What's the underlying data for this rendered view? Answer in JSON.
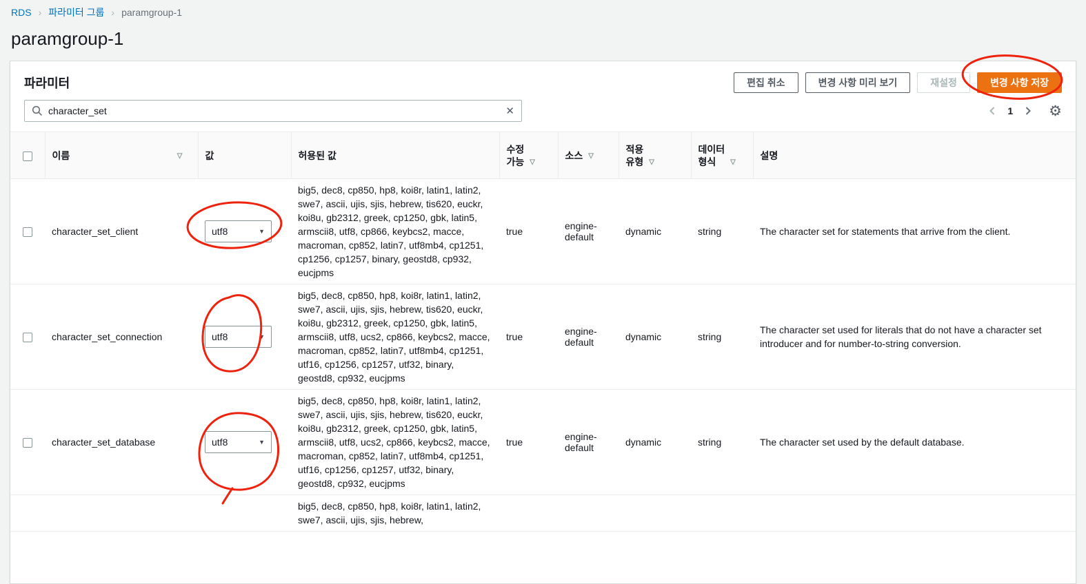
{
  "breadcrumb": {
    "items": [
      {
        "label": "RDS"
      },
      {
        "label": "파라미터 그룹"
      },
      {
        "label": "paramgroup-1"
      }
    ]
  },
  "page": {
    "title": "paramgroup-1"
  },
  "panel": {
    "title": "파라미터",
    "buttons": {
      "cancel_edit": "편집 취소",
      "preview_changes": "변경 사항 미리 보기",
      "reset": "재설정",
      "save_changes": "변경 사항 저장"
    },
    "search": {
      "value": "character_set"
    },
    "pagination": {
      "current_page": "1"
    }
  },
  "colors": {
    "primary_button": "#ec7211",
    "link": "#0073bb",
    "annotation_red": "#ee220d"
  },
  "table": {
    "columns": [
      {
        "label": "이름"
      },
      {
        "label": "값"
      },
      {
        "label": "허용된 값"
      },
      {
        "label": "수정\n가능"
      },
      {
        "label": "소스"
      },
      {
        "label": "적용\n유형"
      },
      {
        "label": "데이터\n형식"
      },
      {
        "label": "설명"
      }
    ],
    "rows": [
      {
        "name": "character_set_client",
        "value": "utf8",
        "allowed": "big5, dec8, cp850, hp8, koi8r, latin1, latin2, swe7, ascii, ujis, sjis, hebrew, tis620, euckr, koi8u, gb2312, greek, cp1250, gbk, latin5, armscii8, utf8, cp866, keybcs2, macce, macroman, cp852, latin7, utf8mb4, cp1251, cp1256, cp1257, binary, geostd8, cp932, eucjpms",
        "modifiable": "true",
        "source": "engine-default",
        "apply_type": "dynamic",
        "data_type": "string",
        "description": "The character set for statements that arrive from the client."
      },
      {
        "name": "character_set_connection",
        "value": "utf8",
        "allowed": "big5, dec8, cp850, hp8, koi8r, latin1, latin2, swe7, ascii, ujis, sjis, hebrew, tis620, euckr, koi8u, gb2312, greek, cp1250, gbk, latin5, armscii8, utf8, ucs2, cp866, keybcs2, macce, macroman, cp852, latin7, utf8mb4, cp1251, utf16, cp1256, cp1257, utf32, binary, geostd8, cp932, eucjpms",
        "modifiable": "true",
        "source": "engine-default",
        "apply_type": "dynamic",
        "data_type": "string",
        "description": "The character set used for literals that do not have a character set introducer and for number-to-string conversion."
      },
      {
        "name": "character_set_database",
        "value": "utf8",
        "allowed": "big5, dec8, cp850, hp8, koi8r, latin1, latin2, swe7, ascii, ujis, sjis, hebrew, tis620, euckr, koi8u, gb2312, greek, cp1250, gbk, latin5, armscii8, utf8, ucs2, cp866, keybcs2, macce, macroman, cp852, latin7, utf8mb4, cp1251, utf16, cp1256, cp1257, utf32, binary, geostd8, cp932, eucjpms",
        "modifiable": "true",
        "source": "engine-default",
        "apply_type": "dynamic",
        "data_type": "string",
        "description": "The character set used by the default database."
      },
      {
        "name": "",
        "value": "",
        "allowed": "big5, dec8, cp850, hp8, koi8r, latin1, latin2, swe7, ascii, ujis, sjis, hebrew,",
        "modifiable": "",
        "source": "",
        "apply_type": "",
        "data_type": "",
        "description": ""
      }
    ]
  }
}
